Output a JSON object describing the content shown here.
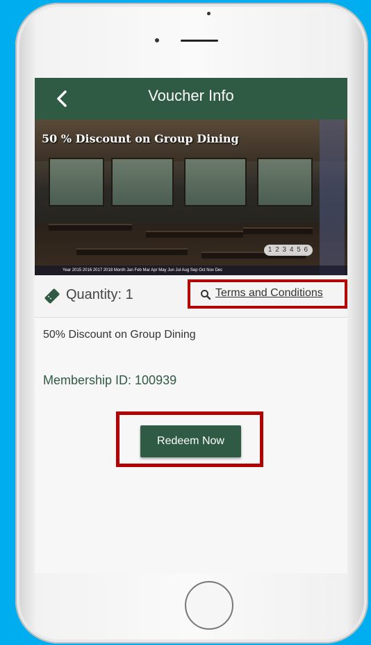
{
  "header": {
    "title": "Voucher Info",
    "back_icon": "chevron-left-icon"
  },
  "banner": {
    "overlay_text": "50 % Discount on Group Dining",
    "pager": "1 2 3 4 5 6",
    "year_strip": "Year 2015 2016 2017 2018 Month Jan Feb Mar Apr May Jun Jul Aug Sep Oct Nov Dec"
  },
  "voucher": {
    "quantity_label": "Quantity: 1",
    "terms_label": "Terms and Conditions",
    "description": "50% Discount on Group Dining",
    "membership": "Membership ID: 100939",
    "redeem_label": "Redeem Now"
  },
  "colors": {
    "accent": "#2f5a43",
    "highlight": "#b30000",
    "background": "#00adef"
  }
}
